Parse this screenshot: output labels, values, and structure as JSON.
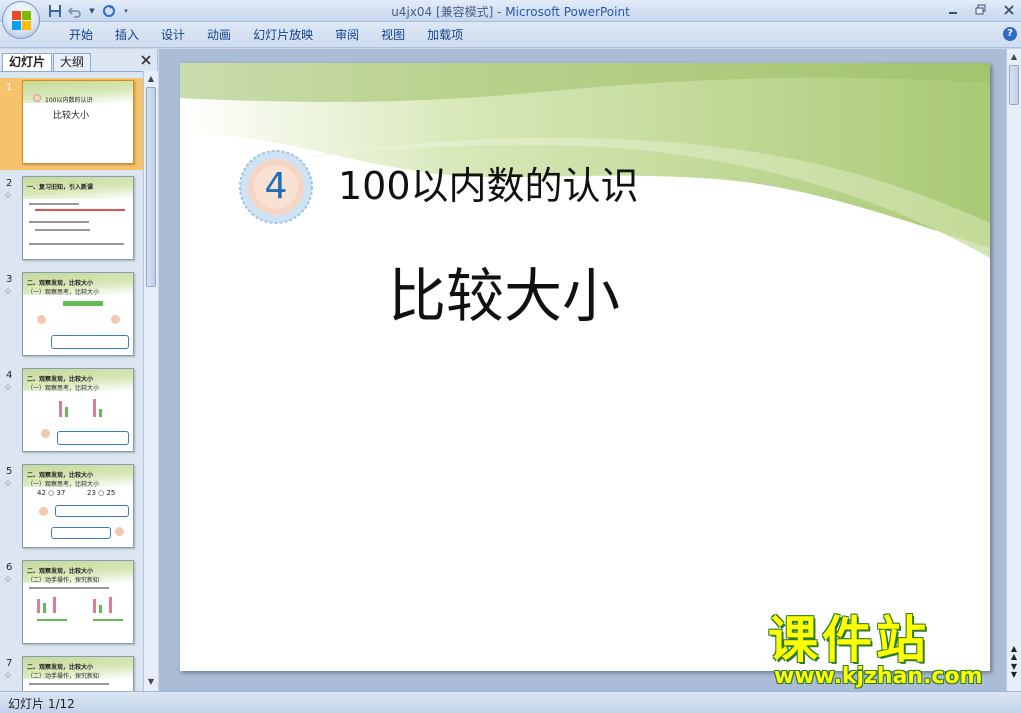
{
  "window": {
    "title_doc": "u4jx04 [兼容模式]",
    "title_sep": " - ",
    "title_app": "Microsoft PowerPoint"
  },
  "ribbon": {
    "tabs": [
      "开始",
      "插入",
      "设计",
      "动画",
      "幻灯片放映",
      "审阅",
      "视图",
      "加载项"
    ]
  },
  "panel": {
    "tab_slides": "幻灯片",
    "tab_outline": "大纲",
    "thumbnails": [
      {
        "num": "1",
        "title": "100以内数的认识",
        "subtitle": "比较大小"
      },
      {
        "num": "2",
        "anim": "☆",
        "title": "一、复习旧知，引入新课"
      },
      {
        "num": "3",
        "anim": "☆",
        "title": "二、观察发现，比较大小",
        "sub": "（一）观察思考，比较大小"
      },
      {
        "num": "4",
        "anim": "☆",
        "title": "二、观察发现，比较大小",
        "sub": "（一）观察思考，比较大小"
      },
      {
        "num": "5",
        "anim": "☆",
        "title": "二、观察发现，比较大小",
        "sub": "（一）观察思考，比较大小",
        "expr1": "42 ○ 37",
        "expr2": "23 ○ 25"
      },
      {
        "num": "6",
        "anim": "☆",
        "title": "二、观察发现，比较大小",
        "sub": "（二）动手操作，探究新知"
      },
      {
        "num": "7",
        "anim": "☆",
        "title": "二、观察发现，比较大小",
        "sub": "（二）动手操作，探究新知"
      }
    ]
  },
  "slide": {
    "badge_number": "4",
    "title": "100以内数的认识",
    "subtitle": "比较大小"
  },
  "watermark": {
    "cn": "课件站",
    "url": "www.kjzhan.com"
  },
  "status": {
    "slide_counter": "幻灯片 1/12"
  },
  "colors": {
    "accent_blue": "#15428b",
    "selected_thumb": "#f6c26b",
    "slide_green": "#b9d38a",
    "badge_text": "#1e6fb8",
    "watermark": "#ffff00"
  }
}
